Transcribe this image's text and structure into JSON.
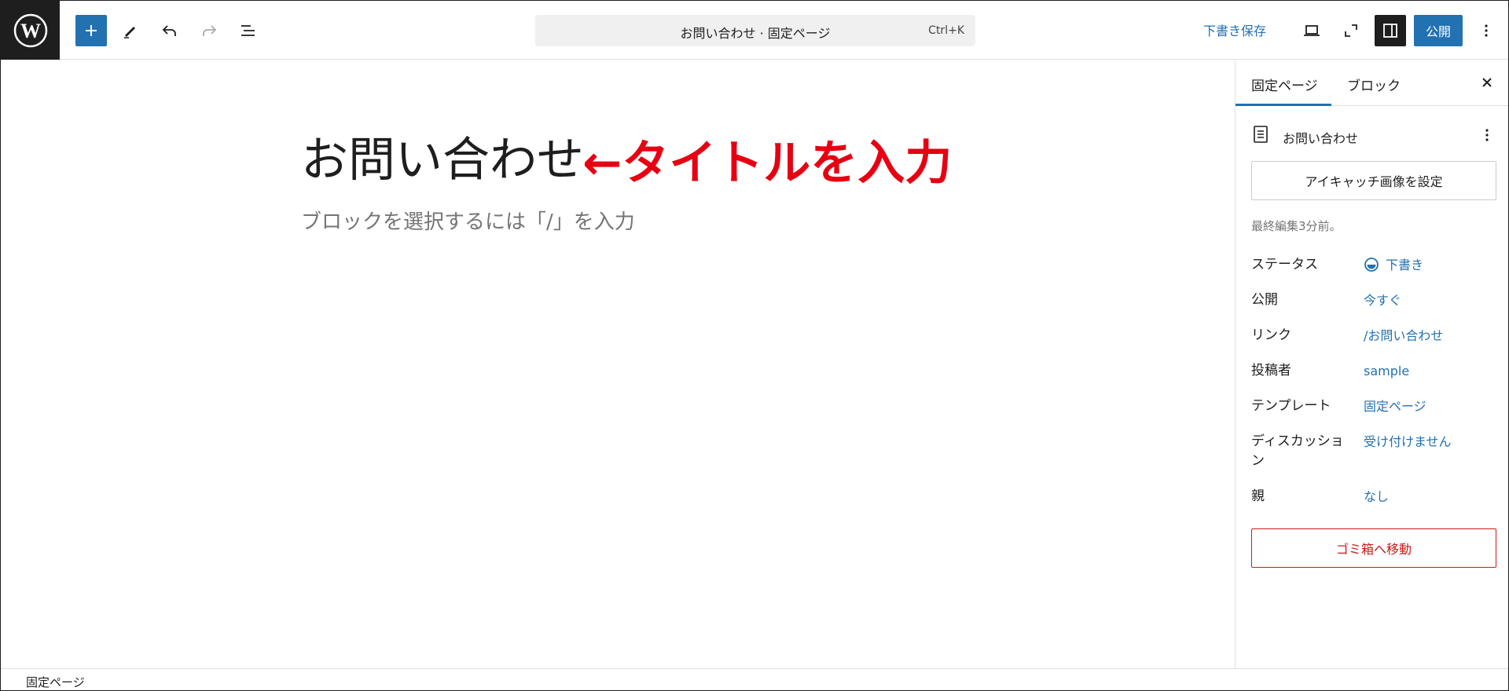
{
  "header": {
    "logo_icon": "wordpress-icon",
    "command_title": "お問い合わせ · 固定ページ",
    "command_shortcut": "Ctrl+K",
    "save_draft_label": "下書き保存",
    "publish_label": "公開",
    "accent_color": "#2271b1"
  },
  "editor": {
    "title": "お問い合わせ",
    "annotation": "←タイトルを入力",
    "annotation_color": "#e60012",
    "block_placeholder": "ブロックを選択するには「/」を入力"
  },
  "sidebar": {
    "tabs": [
      {
        "label": "固定ページ"
      },
      {
        "label": "ブロック"
      }
    ],
    "page_name": "お問い合わせ",
    "featured_image_label": "アイキャッチ画像を設定",
    "last_edited": "最終編集3分前。",
    "props": [
      {
        "label": "ステータス",
        "value": "下書き"
      },
      {
        "label": "公開",
        "value": "今すぐ"
      },
      {
        "label": "リンク",
        "value": "/お問い合わせ"
      },
      {
        "label": "投稿者",
        "value": "sample"
      },
      {
        "label": "テンプレート",
        "value": "固定ページ"
      },
      {
        "label": "ディスカッション",
        "value": "受け付けません"
      },
      {
        "label": "親",
        "value": "なし"
      }
    ],
    "trash_label": "ゴミ箱へ移動",
    "trash_color": "#cc1818"
  },
  "footer": {
    "breadcrumb": "固定ページ"
  }
}
